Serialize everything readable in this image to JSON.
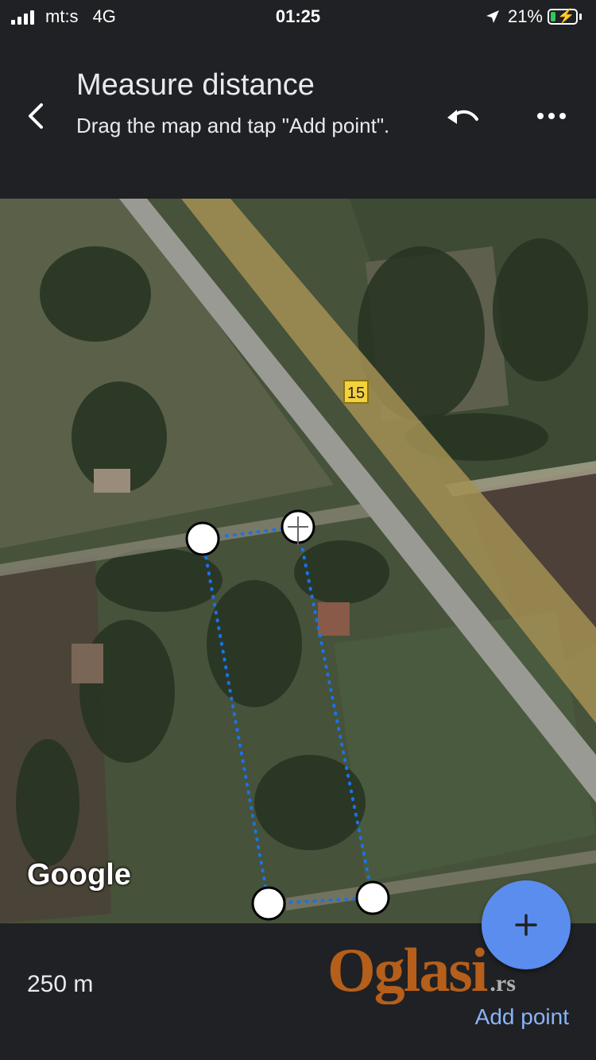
{
  "status_bar": {
    "carrier": "mt:s",
    "network": "4G",
    "time": "01:25",
    "battery": "21%",
    "battery_level": 0.21,
    "icons": [
      "signal-icon",
      "location-arrow-icon",
      "battery-charging-icon"
    ]
  },
  "header": {
    "title": "Measure distance",
    "subtitle": "Drag the map and tap \"Add point\".",
    "icons": [
      "back-arrow-icon",
      "undo-icon",
      "more-options-icon"
    ]
  },
  "map": {
    "route_label": "15",
    "logo": "Google",
    "icons": [
      "add-icon"
    ],
    "colors": {
      "path": "#1a73e8",
      "point_fill": "#ffffff",
      "point_stroke": "#000000"
    }
  },
  "bottom": {
    "distance": "250 m",
    "add_point_label": "Add point",
    "accent": "#8ab4f8"
  },
  "watermark": {
    "brand": "Oglasi",
    "tld": ".rs"
  }
}
